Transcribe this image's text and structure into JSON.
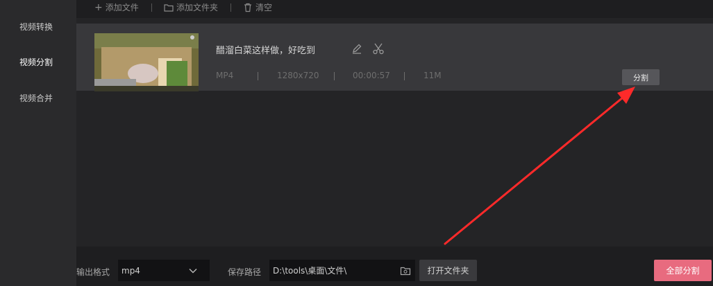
{
  "sidebar": {
    "items": [
      {
        "label": "视频转换"
      },
      {
        "label": "视频分割"
      },
      {
        "label": "视频合并"
      }
    ]
  },
  "toolbar": {
    "add_file": "添加文件",
    "add_folder": "添加文件夹",
    "clear": "清空"
  },
  "file": {
    "title": "醋溜白菜这样做，好吃到",
    "format": "MP4",
    "resolution": "1280x720",
    "duration": "00:00:57",
    "size": "11M",
    "split_label": "分割"
  },
  "bottom": {
    "output_format_label": "输出格式",
    "output_format_value": "mp4",
    "save_path_label": "保存路径",
    "save_path_value": "D:\\tools\\桌面\\文件\\",
    "open_folder_label": "打开文件夹",
    "split_all_label": "全部分割"
  },
  "colors": {
    "accent": "#e86b7f",
    "arrow": "#ff2a2a"
  }
}
